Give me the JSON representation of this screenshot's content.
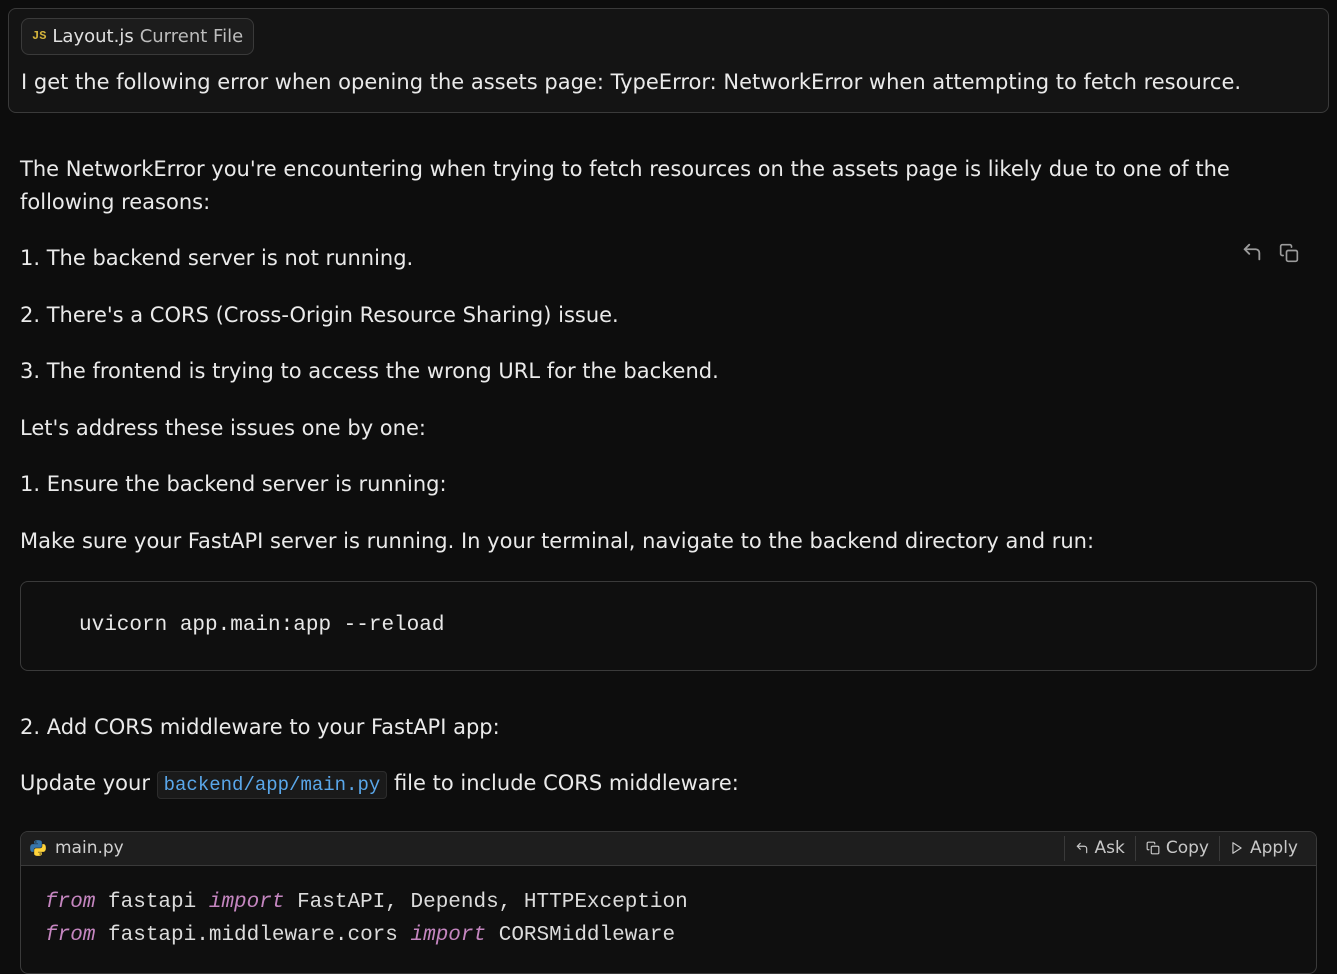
{
  "user_message": {
    "file_chip": {
      "icon_text": "JS",
      "file_name": "Layout.js",
      "tag": "Current File"
    },
    "text": "I get the following error when opening the assets page: TypeError: NetworkError when attempting to fetch resource."
  },
  "response": {
    "intro": "The NetworkError you're encountering when trying to fetch resources on the assets page is likely due to one of the following reasons:",
    "reason1": "1. The backend server is not running.",
    "reason2": "2. There's a CORS (Cross-Origin Resource Sharing) issue.",
    "reason3": "3. The frontend is trying to access the wrong URL for the backend.",
    "lets": "Let's address these issues one by one:",
    "step1_title": "1. Ensure the backend server is running:",
    "step1_body": "Make sure your FastAPI server is running. In your terminal, navigate to the backend directory and run:",
    "step1_code": "uvicorn app.main:app --reload",
    "step2_title": "2. Add CORS middleware to your FastAPI app:",
    "step2_body_pre": "Update your ",
    "step2_body_code": "backend/app/main.py",
    "step2_body_post": " file to include CORS middleware:"
  },
  "code_panel": {
    "filename": "main.py",
    "actions": {
      "ask": "Ask",
      "copy": "Copy",
      "apply": "Apply"
    },
    "line1": {
      "kw1": "from",
      "mod": " fastapi ",
      "kw2": "import",
      "names": " FastAPI, Depends, HTTPException"
    },
    "line2": {
      "kw1": "from",
      "mod": " fastapi.middleware.cors ",
      "kw2": "import",
      "names": " CORSMiddleware"
    }
  }
}
